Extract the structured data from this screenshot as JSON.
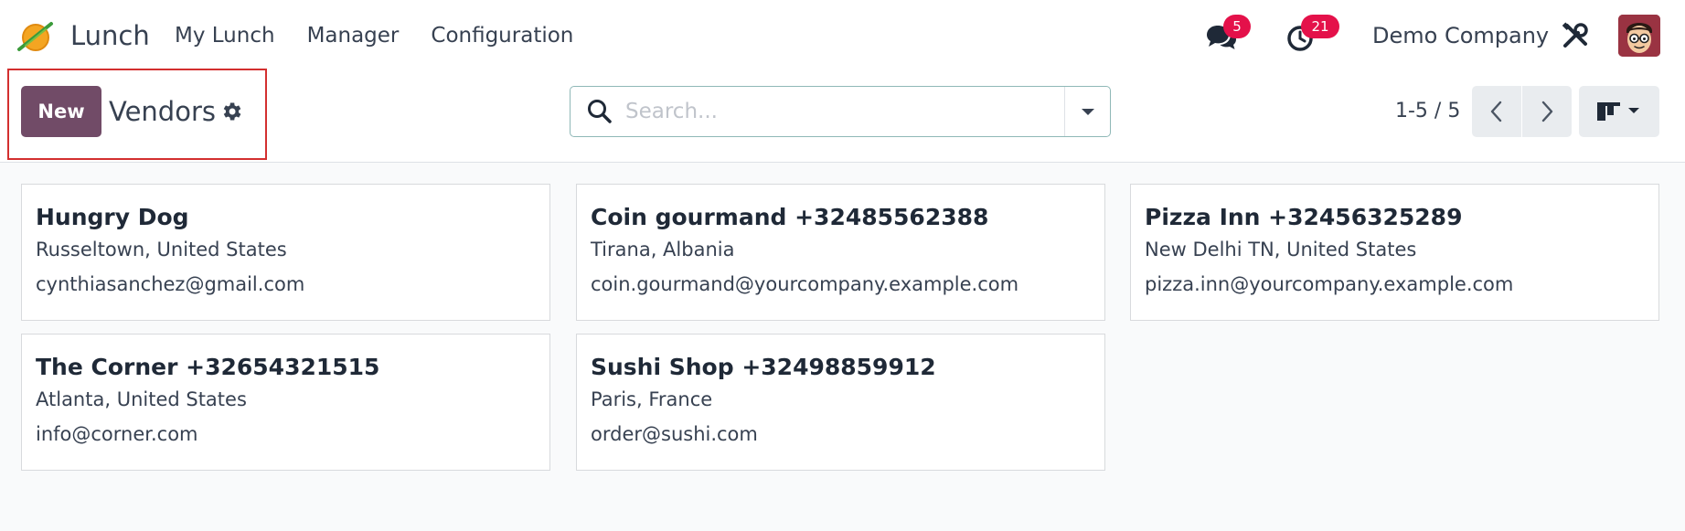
{
  "navbar": {
    "app_name": "Lunch",
    "menu": [
      {
        "label": "My Lunch"
      },
      {
        "label": "Manager"
      },
      {
        "label": "Configuration"
      }
    ],
    "messages_count": "5",
    "activities_count": "21",
    "company": "Demo Company"
  },
  "control_panel": {
    "new_label": "New",
    "title": "Vendors",
    "search_placeholder": "Search...",
    "pager": "1-5 / 5"
  },
  "vendors": [
    {
      "name": "Hungry Dog",
      "location": "Russeltown, United States",
      "email": "cynthiasanchez@gmail.com"
    },
    {
      "name": "Coin gourmand +32485562388",
      "location": "Tirana, Albania",
      "email": "coin.gourmand@yourcompany.example.com"
    },
    {
      "name": "Pizza Inn +32456325289",
      "location": "New Delhi TN, United States",
      "email": "pizza.inn@yourcompany.example.com"
    },
    {
      "name": "The Corner +32654321515",
      "location": "Atlanta, United States",
      "email": "info@corner.com"
    },
    {
      "name": "Sushi Shop +32498859912",
      "location": "Paris, France",
      "email": "order@sushi.com"
    }
  ],
  "colors": {
    "primary": "#714b67",
    "badge": "#e4114a",
    "highlight": "#d32f2f"
  },
  "icons": [
    "lunch-logo-icon",
    "chat-icon",
    "clock-icon",
    "tools-icon",
    "gear-icon",
    "search-icon",
    "caret-down-icon",
    "chevron-left-icon",
    "chevron-right-icon",
    "kanban-view-icon"
  ]
}
